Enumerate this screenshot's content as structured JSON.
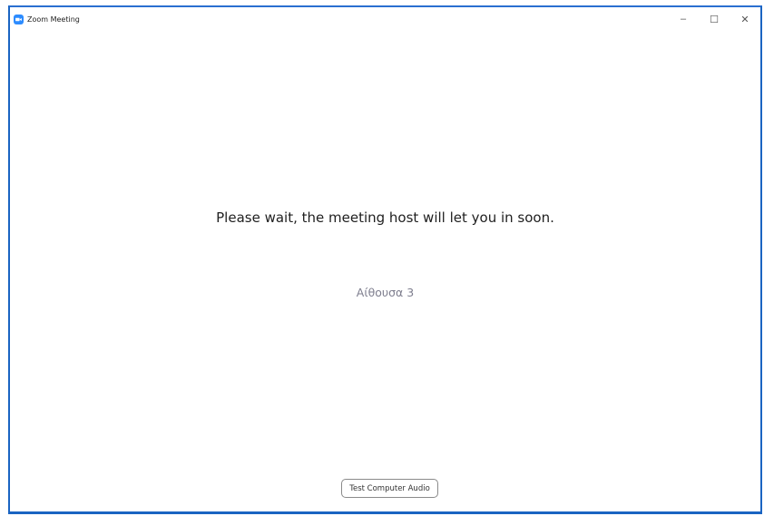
{
  "window": {
    "title": "Zoom Meeting",
    "app_icon": "zoom-camera-icon",
    "accent_color": "#1a64c2",
    "controls": {
      "minimize": "–",
      "maximize": "☐",
      "close": "✕"
    }
  },
  "main": {
    "wait_message": "Please wait, the meeting host will let you in soon.",
    "room_name": "Αίθουσα 3",
    "test_audio_label": "Test Computer Audio"
  }
}
